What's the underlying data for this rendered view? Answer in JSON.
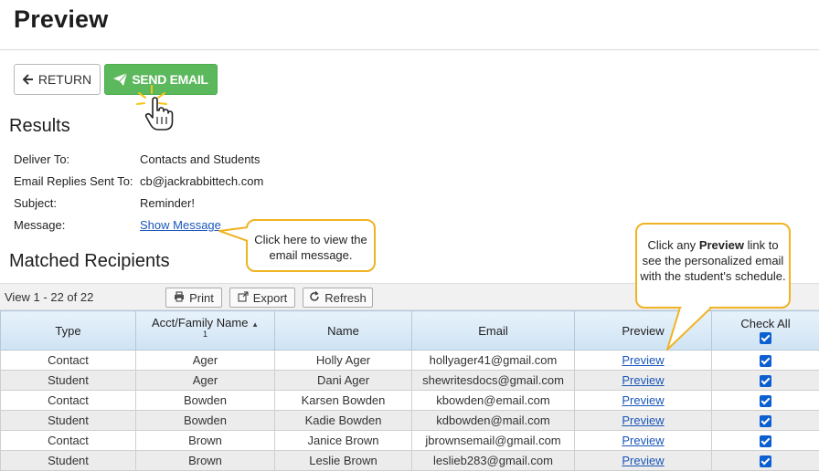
{
  "header": {
    "title": "Preview"
  },
  "actions": {
    "return_label": "RETURN",
    "send_label": "SEND EMAIL"
  },
  "results": {
    "title": "Results",
    "deliver_to": {
      "label": "Deliver To:",
      "value": "Contacts and Students"
    },
    "replies_to": {
      "label": "Email Replies Sent To:",
      "value": "cb@jackrabbittech.com"
    },
    "subject": {
      "label": "Subject:",
      "value": "Reminder!"
    },
    "message": {
      "label": "Message:",
      "link": "Show Message"
    }
  },
  "callouts": {
    "view_message": "Click here to view the email message.",
    "preview_intro": "Click any",
    "preview_bold": "Preview",
    "preview_rest": "link to see the personalized email with the student's schedule."
  },
  "recipients": {
    "title": "Matched Recipients",
    "view_text": "View 1 - 22 of 22",
    "toolbar": {
      "print": "Print",
      "export": "Export",
      "refresh": "Refresh"
    },
    "columns": {
      "type": "Type",
      "acct": "Acct/Family Name",
      "sort_index": "1",
      "name": "Name",
      "email": "Email",
      "preview": "Preview",
      "check_all": "Check All"
    },
    "rows": [
      {
        "type": "Contact",
        "acct": "Ager",
        "name": "Holly Ager",
        "email": "hollyager41@gmail.com",
        "preview": "Preview",
        "checked": true
      },
      {
        "type": "Student",
        "acct": "Ager",
        "name": "Dani Ager",
        "email": "shewritesdocs@gmail.com",
        "preview": "Preview",
        "checked": true
      },
      {
        "type": "Contact",
        "acct": "Bowden",
        "name": "Karsen Bowden",
        "email": "kbowden@email.com",
        "preview": "Preview",
        "checked": true
      },
      {
        "type": "Student",
        "acct": "Bowden",
        "name": "Kadie Bowden",
        "email": "kdbowden@mail.com",
        "preview": "Preview",
        "checked": true
      },
      {
        "type": "Contact",
        "acct": "Brown",
        "name": "Janice Brown",
        "email": "jbrownsemail@gmail.com",
        "preview": "Preview",
        "checked": true
      },
      {
        "type": "Student",
        "acct": "Brown",
        "name": "Leslie Brown",
        "email": "leslieb283@gmail.com",
        "preview": "Preview",
        "checked": true
      }
    ]
  },
  "colors": {
    "send_button": "#5cb85c",
    "callout_border": "#f0b323",
    "link": "#1a56b8",
    "header_row": "#d7e9f7"
  }
}
